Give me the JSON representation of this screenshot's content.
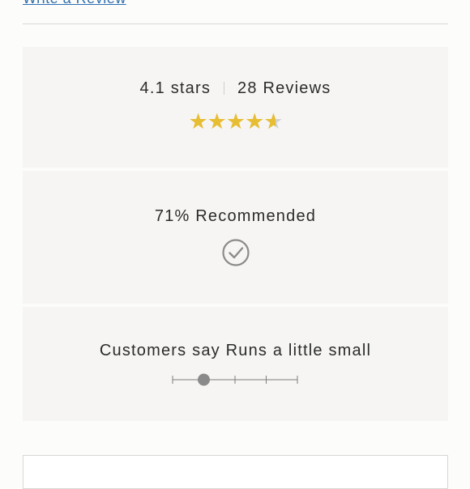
{
  "write_review": {
    "label": "Write a Review"
  },
  "rating_summary": {
    "rating_text": "4.1 stars",
    "reviews_text": "28 Reviews",
    "rating_value": 4.1,
    "max_stars": 5,
    "star_color": "#e6bd33",
    "empty_star_color": "#d3d3d3"
  },
  "recommendation": {
    "text": "71% Recommended",
    "icon": "check-circle-icon"
  },
  "fit": {
    "text": "Customers say Runs a little small",
    "scale_steps": 5,
    "selected_index": 1,
    "marker_color": "#8a8a8a"
  }
}
